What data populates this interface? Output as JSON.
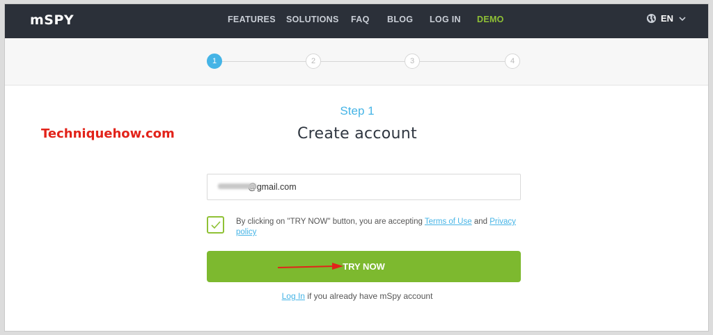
{
  "nav": {
    "logo": "mSPY",
    "items": [
      {
        "label": "FEATURES"
      },
      {
        "label": "SOLUTIONS"
      },
      {
        "label": "FAQ"
      },
      {
        "label": "BLOG"
      },
      {
        "label": "LOG IN"
      },
      {
        "label": "DEMO"
      }
    ],
    "language": "EN"
  },
  "stepper": {
    "steps": [
      "1",
      "2",
      "3",
      "4"
    ],
    "active_step": 1
  },
  "watermark": "Techniquehow.com",
  "form": {
    "step_label": "Step 1",
    "title": "Create account",
    "email_value": "@gmail.com",
    "terms_prefix": "By clicking on \"TRY NOW\" button, you are accepting ",
    "terms_link": "Terms of Use",
    "terms_and": " and ",
    "privacy_link": "Privacy policy",
    "submit_label": "TRY NOW",
    "login_link": "Log In",
    "login_suffix": " if you already have mSpy account"
  },
  "colors": {
    "nav_bg": "#2b3039",
    "accent_green": "#7db92f",
    "accent_blue": "#45b4e6",
    "demo_green": "#8fc135",
    "watermark_red": "#e2231a"
  }
}
